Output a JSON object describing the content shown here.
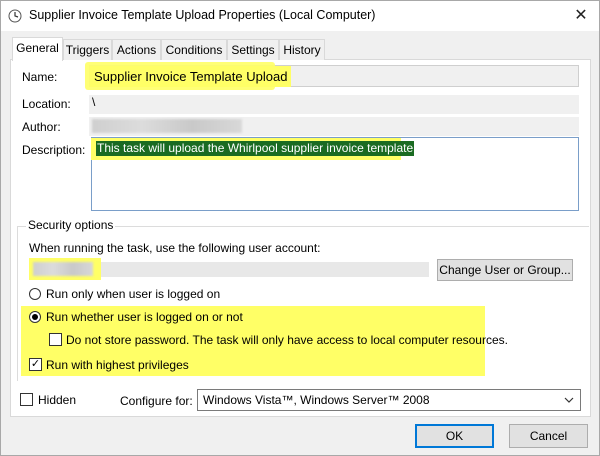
{
  "window": {
    "title": "Supplier Invoice Template Upload Properties (Local Computer)",
    "close_glyph": "✕"
  },
  "tabs": [
    {
      "label": "General",
      "active": true
    },
    {
      "label": "Triggers"
    },
    {
      "label": "Actions"
    },
    {
      "label": "Conditions"
    },
    {
      "label": "Settings"
    },
    {
      "label": "History"
    }
  ],
  "general": {
    "name_label": "Name:",
    "name_value": "Supplier Invoice Template Upload",
    "location_label": "Location:",
    "location_value": "\\",
    "author_label": "Author:",
    "description_label": "Description:",
    "description_value": "This task will upload the Whirlpool supplier invoice template"
  },
  "security": {
    "group_title": "Security options",
    "account_prompt": "When running the task, use the following user account:",
    "change_button": "Change User or Group...",
    "radio_logged_on": "Run only when user is logged on",
    "radio_whether": "Run whether user is logged on or not",
    "no_store_password": "Do not store password.  The task will only have access to local computer resources.",
    "highest_privileges": "Run with highest privileges"
  },
  "footer": {
    "hidden_label": "Hidden",
    "configure_label": "Configure for:",
    "configure_value": "Windows Vista™, Windows Server™ 2008",
    "ok_button": "OK",
    "cancel_button": "Cancel"
  },
  "colors": {
    "highlight": "#ffff66",
    "selection": "#1a6b22",
    "focus_border": "#0078d7"
  }
}
